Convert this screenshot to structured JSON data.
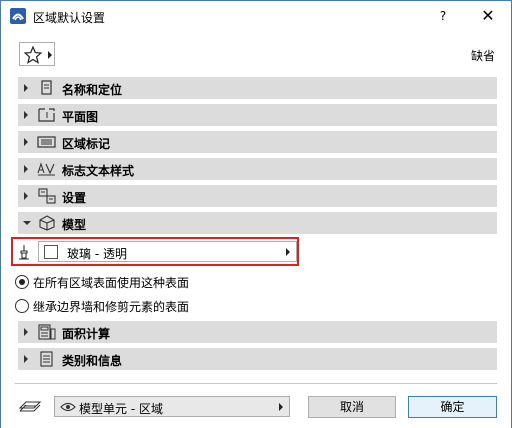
{
  "window": {
    "title": "区域默认设置",
    "help_label": "?",
    "close_label": "✕"
  },
  "toolbar": {
    "favorites_icon": "star-icon",
    "default_label": "缺省"
  },
  "panels": [
    {
      "label": "名称和定位",
      "icon": "name-position-icon",
      "expanded": false
    },
    {
      "label": "平面图",
      "icon": "floor-plan-icon",
      "expanded": false
    },
    {
      "label": "区域标记",
      "icon": "zone-stamp-icon",
      "expanded": false
    },
    {
      "label": "标志文本样式",
      "icon": "text-style-icon",
      "expanded": false
    },
    {
      "label": "设置",
      "icon": "settings-icon",
      "expanded": false
    },
    {
      "label": "模型",
      "icon": "model-icon",
      "expanded": true
    },
    {
      "label": "面积计算",
      "icon": "area-calc-icon",
      "expanded": false
    },
    {
      "label": "类别和信息",
      "icon": "category-info-icon",
      "expanded": false
    }
  ],
  "model": {
    "surface_value": "玻璃 - 透明",
    "swatch_color": "#ffffff",
    "options": [
      {
        "label": "在所有区域表面使用这种表面",
        "checked": true
      },
      {
        "label": "继承边界墙和修剪元素的表面",
        "checked": false
      }
    ]
  },
  "footer": {
    "layer_value": "模型单元 - 区域",
    "cancel_label": "取消",
    "ok_label": "确定"
  },
  "colors": {
    "highlight_border": "#e02020",
    "panel_bg": "#dcdcdc",
    "primary_button_border": "#3c7fb1"
  }
}
